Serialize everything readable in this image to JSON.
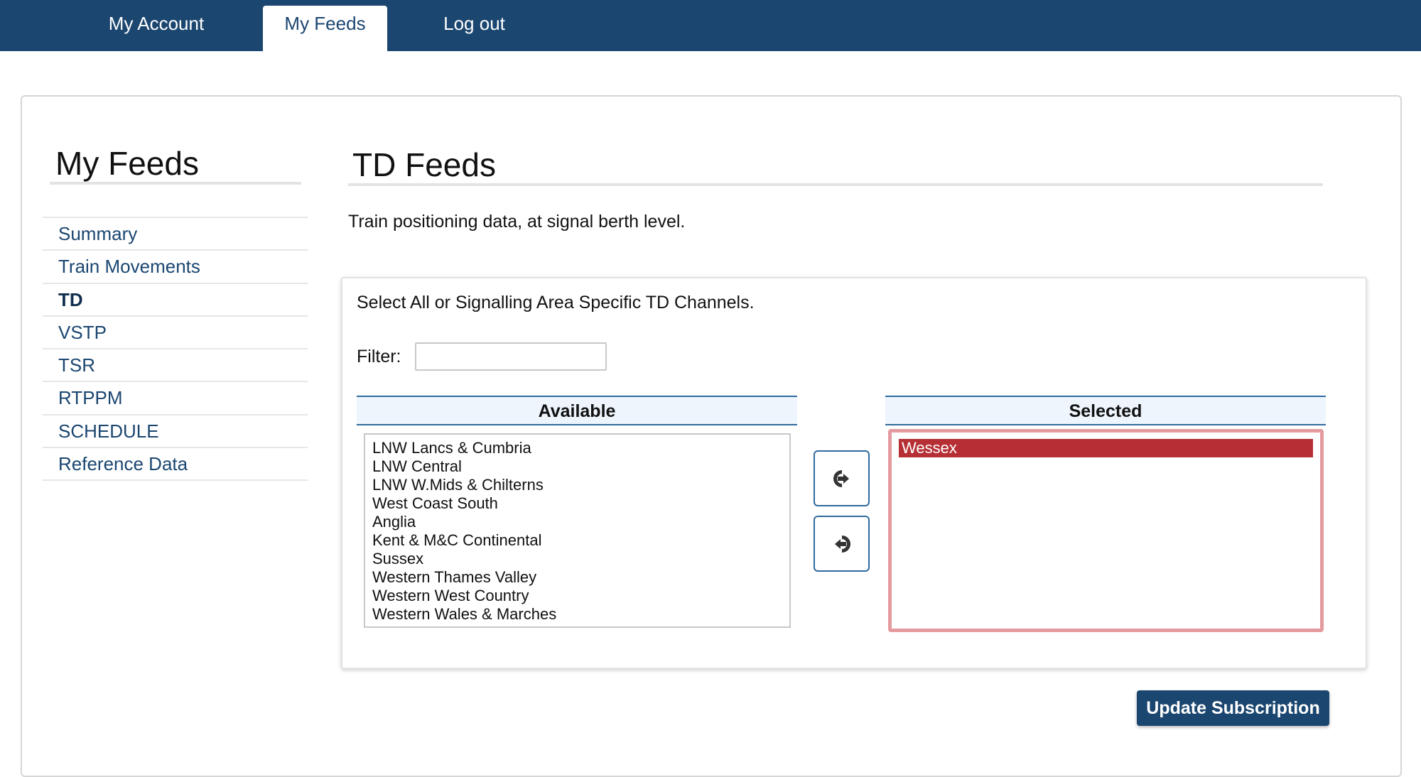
{
  "nav": {
    "tabs": [
      {
        "label": "My Account"
      },
      {
        "label": "My Feeds"
      },
      {
        "label": "Log out"
      }
    ],
    "active": "My Feeds"
  },
  "sidebar": {
    "title": "My Feeds",
    "items": [
      {
        "label": "Summary"
      },
      {
        "label": "Train Movements"
      },
      {
        "label": "TD"
      },
      {
        "label": "VSTP"
      },
      {
        "label": "TSR"
      },
      {
        "label": "RTPPM"
      },
      {
        "label": "SCHEDULE"
      },
      {
        "label": "Reference Data"
      }
    ],
    "active": "TD"
  },
  "main": {
    "title": "TD Feeds",
    "description": "Train positioning data, at signal berth level.",
    "instructions": "Select All or Signalling Area Specific TD Channels.",
    "filter": {
      "label": "Filter:",
      "value": "",
      "placeholder": ""
    },
    "available": {
      "header": "Available",
      "items": [
        "LNW Lancs & Cumbria",
        "LNW Central",
        "LNW W.Mids & Chilterns",
        "West Coast South",
        "Anglia",
        "Kent & M&C Continental",
        "Sussex",
        "Western Thames Valley",
        "Western West Country",
        "Western Wales & Marches"
      ]
    },
    "selected": {
      "header": "Selected",
      "items": [
        "Wessex"
      ],
      "highlighted": "Wessex"
    },
    "buttons": {
      "add_icon": "arrow-right-icon",
      "remove_icon": "arrow-left-icon",
      "update_label": "Update Subscription"
    }
  },
  "colors": {
    "brand": "#1b4670",
    "selected_item": "#b52f34",
    "selected_border": "#e49a9f",
    "list_header_bg": "#eef5fd"
  }
}
